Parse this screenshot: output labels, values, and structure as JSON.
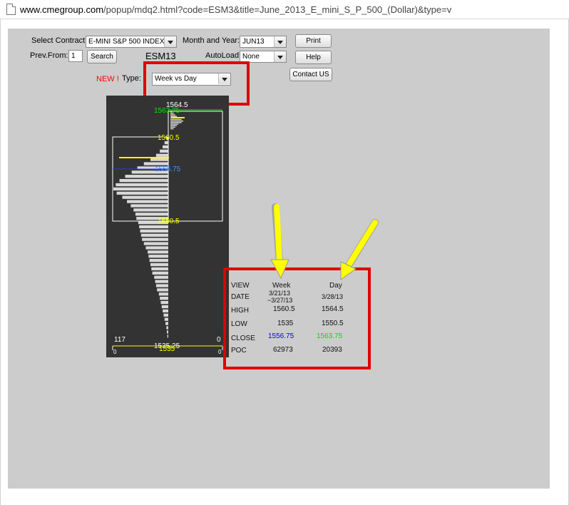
{
  "browser": {
    "url_host": "www.cmegroup.com",
    "url_path": "/popup/mdq2.html?code=ESM3&title=June_2013_E_mini_S_P_500_(Dollar)&type=v"
  },
  "form": {
    "contract_label": "Select Contract:",
    "contract_value": "E-MINI S&P 500 INDEX",
    "month_label": "Month and Year:",
    "month_value": "JUN13",
    "print_button": "Print",
    "prev_from_label": "Prev.From:",
    "prev_from_value": "1",
    "search_button": "Search",
    "symbol": "ESM13",
    "autoload_label": "AutoLoad:",
    "autoload_value": "None",
    "help_button": "Help",
    "contact_button": "Contact US",
    "new_label": "NEW !",
    "type_label": "Type:",
    "type_value": "Week vs Day"
  },
  "colors": {
    "annotation_red": "#e00000",
    "arrow_yellow": "#ffff00",
    "chart_bg": "#333333",
    "price_yellow": "#ffff00",
    "price_green": "#00ee00",
    "price_blue": "#3399ff"
  },
  "chart_data": {
    "type": "bar",
    "orientation": "horizontal-profile",
    "price_labels": [
      {
        "text": "1564.5",
        "price": 1564.5,
        "color": "white"
      },
      {
        "text": "1563.75",
        "price": 1563.75,
        "color": "green"
      },
      {
        "text": "1560.5",
        "price": 1560.5,
        "color": "yellow"
      },
      {
        "text": "1556.75",
        "price": 1556.75,
        "color": "blue"
      },
      {
        "text": "1550.5",
        "price": 1550.5,
        "color": "yellow"
      },
      {
        "text": "1535.25",
        "price": 1535.25,
        "color": "white"
      },
      {
        "text": "1535",
        "price": 1535,
        "color": "yellow"
      }
    ],
    "corner_labels": {
      "left_max": "117",
      "right_zero": "0",
      "bottom_left": "0",
      "bottom_right": "0"
    },
    "price_range": [
      1535,
      1564.5
    ],
    "week_max_volume": 117,
    "week_profile": [
      4,
      8,
      12,
      18,
      26,
      38,
      52,
      66,
      78,
      92,
      104,
      112,
      117,
      110,
      98,
      88,
      80,
      74,
      70,
      68,
      64,
      62,
      60,
      58,
      56,
      52,
      48,
      44,
      42,
      40,
      38,
      36,
      34,
      30,
      28,
      26,
      24,
      20,
      18,
      16,
      14,
      12,
      10,
      8,
      6,
      4,
      3,
      2
    ],
    "day_profile": [
      2,
      4,
      6,
      8,
      12,
      14,
      16,
      14,
      10,
      8,
      6,
      4
    ]
  },
  "table": {
    "headers": [
      "VIEW",
      "Week",
      "Day"
    ],
    "rows": [
      {
        "label": "DATE",
        "week": "3/21/13 ~3/27/13",
        "day": "3/28/13"
      },
      {
        "label": "HIGH",
        "week": "1560.5",
        "day": "1564.5"
      },
      {
        "label": "LOW",
        "week": "1535",
        "day": "1550.5"
      },
      {
        "label": "CLOSE",
        "week": "1556.75",
        "day": "1563.75"
      },
      {
        "label": "POC",
        "week": "62973",
        "day": "20393"
      }
    ],
    "date_week_line1": "3/21/13",
    "date_week_line2": "~3/27/13"
  }
}
